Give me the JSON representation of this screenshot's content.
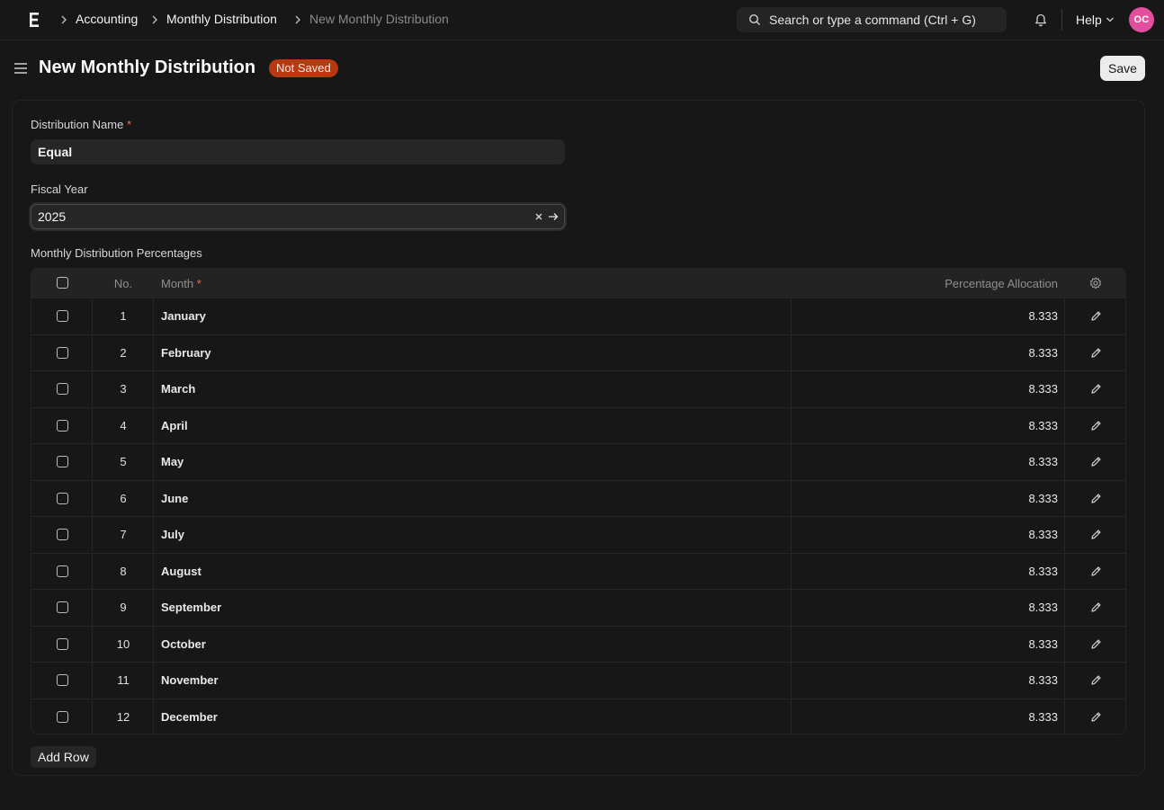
{
  "navbar": {
    "breadcrumbs": [
      "Accounting",
      "Monthly Distribution",
      "New Monthly Distribution"
    ],
    "search_placeholder": "Search or type a command (Ctrl + G)",
    "help_label": "Help",
    "avatar_initials": "OC"
  },
  "header": {
    "title": "New Monthly Distribution",
    "status_badge": "Not Saved",
    "save_label": "Save"
  },
  "form": {
    "distribution_name": {
      "label": "Distribution Name",
      "required": "*",
      "value": "Equal"
    },
    "fiscal_year": {
      "label": "Fiscal Year",
      "value": "2025"
    },
    "table_label": "Monthly Distribution Percentages"
  },
  "table": {
    "columns": {
      "no": "No.",
      "month": "Month",
      "month_required": "*",
      "percentage": "Percentage Allocation"
    },
    "rows": [
      {
        "no": "1",
        "month": "January",
        "percentage": "8.333"
      },
      {
        "no": "2",
        "month": "February",
        "percentage": "8.333"
      },
      {
        "no": "3",
        "month": "March",
        "percentage": "8.333"
      },
      {
        "no": "4",
        "month": "April",
        "percentage": "8.333"
      },
      {
        "no": "5",
        "month": "May",
        "percentage": "8.333"
      },
      {
        "no": "6",
        "month": "June",
        "percentage": "8.333"
      },
      {
        "no": "7",
        "month": "July",
        "percentage": "8.333"
      },
      {
        "no": "8",
        "month": "August",
        "percentage": "8.333"
      },
      {
        "no": "9",
        "month": "September",
        "percentage": "8.333"
      },
      {
        "no": "10",
        "month": "October",
        "percentage": "8.333"
      },
      {
        "no": "11",
        "month": "November",
        "percentage": "8.333"
      },
      {
        "no": "12",
        "month": "December",
        "percentage": "8.333"
      }
    ],
    "add_row_label": "Add Row"
  },
  "colors": {
    "background": "#171717",
    "badge": "#b8380f",
    "avatar": "#e34f9e",
    "required": "#e46d4b"
  },
  "icons": [
    "app-logo-icon",
    "chevron-right-icon",
    "search-icon",
    "bell-icon",
    "chevron-down-icon",
    "hamburger-icon",
    "clear-icon",
    "arrow-right-icon",
    "gear-icon",
    "edit-icon"
  ]
}
